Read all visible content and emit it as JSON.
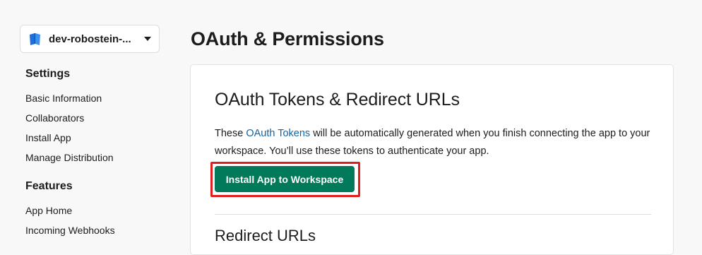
{
  "sidebar": {
    "app_name": "dev-robostein-...",
    "sections": [
      {
        "title": "Settings",
        "items": [
          "Basic Information",
          "Collaborators",
          "Install App",
          "Manage Distribution"
        ]
      },
      {
        "title": "Features",
        "items": [
          "App Home",
          "Incoming Webhooks"
        ]
      }
    ]
  },
  "main": {
    "page_title": "OAuth & Permissions",
    "card": {
      "title": "OAuth Tokens & Redirect URLs",
      "desc_before": "These ",
      "desc_link": "OAuth Tokens",
      "desc_after": " will be automatically generated when you finish connecting the app to your workspace. You’ll use these tokens to authenticate your app.",
      "install_button": "Install App to Workspace",
      "redirect_title": "Redirect URLs"
    }
  },
  "colors": {
    "primary_button": "#007a5a",
    "link": "#1264a3",
    "highlight": "#e01e1e"
  },
  "icons": {
    "app": "book-icon",
    "dropdown": "caret-down-icon"
  }
}
